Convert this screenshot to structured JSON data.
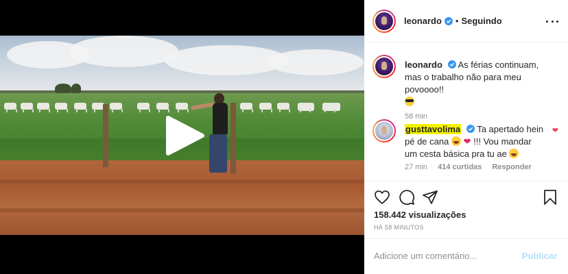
{
  "post": {
    "author": "leonardo",
    "separator": "•",
    "follow_status": "Seguindo"
  },
  "caption": {
    "author": "leonardo",
    "text": "As férias continuam, mas o trabalho não para meu povoooo!!",
    "time": "58 min"
  },
  "comment": {
    "author": "gusttavolima",
    "text_1": "Ta apertado hein pé de cana",
    "text_2": "!!! Vou mandar um cesta básica pra tu ae",
    "time": "27 min",
    "likes": "414 curtidas",
    "reply": "Responder"
  },
  "stats": {
    "views": "158.442 visualizações",
    "posted": "HÁ 58 MINUTOS"
  },
  "composer": {
    "placeholder": "Adicione um comentário...",
    "submit": "Publicar"
  },
  "icons": {
    "verified": "verified-badge-icon",
    "like": "heart-outline-icon",
    "comment": "comment-bubble-icon",
    "share": "send-paper-plane-icon",
    "save": "bookmark-icon",
    "more": "more-dots-icon",
    "play": "play-icon"
  },
  "colors": {
    "verified": "#3897f0",
    "highlight": "#f3f300",
    "heart": "#ed4956",
    "publish_disabled": "#b2dffc"
  }
}
